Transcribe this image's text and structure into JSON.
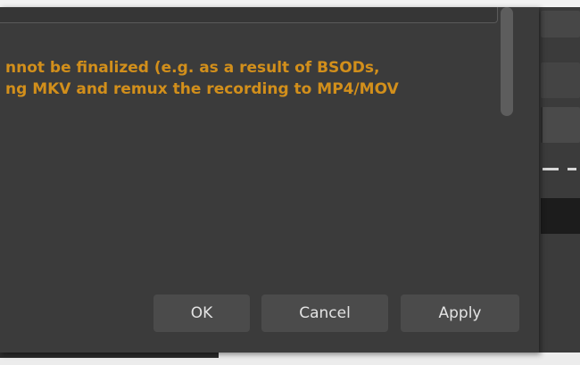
{
  "warning": {
    "line1": "nnot be finalized (e.g. as a result of BSODs,",
    "line2": "ng MKV and remux the recording to MP4/MOV"
  },
  "buttons": {
    "ok_label": "OK",
    "cancel_label": "Cancel",
    "apply_label": "Apply"
  },
  "colors": {
    "warning_text": "#d28f1b",
    "dialog_bg": "#3b3b3b",
    "button_bg": "#4b4b4b",
    "button_text": "#e3e3e3"
  }
}
